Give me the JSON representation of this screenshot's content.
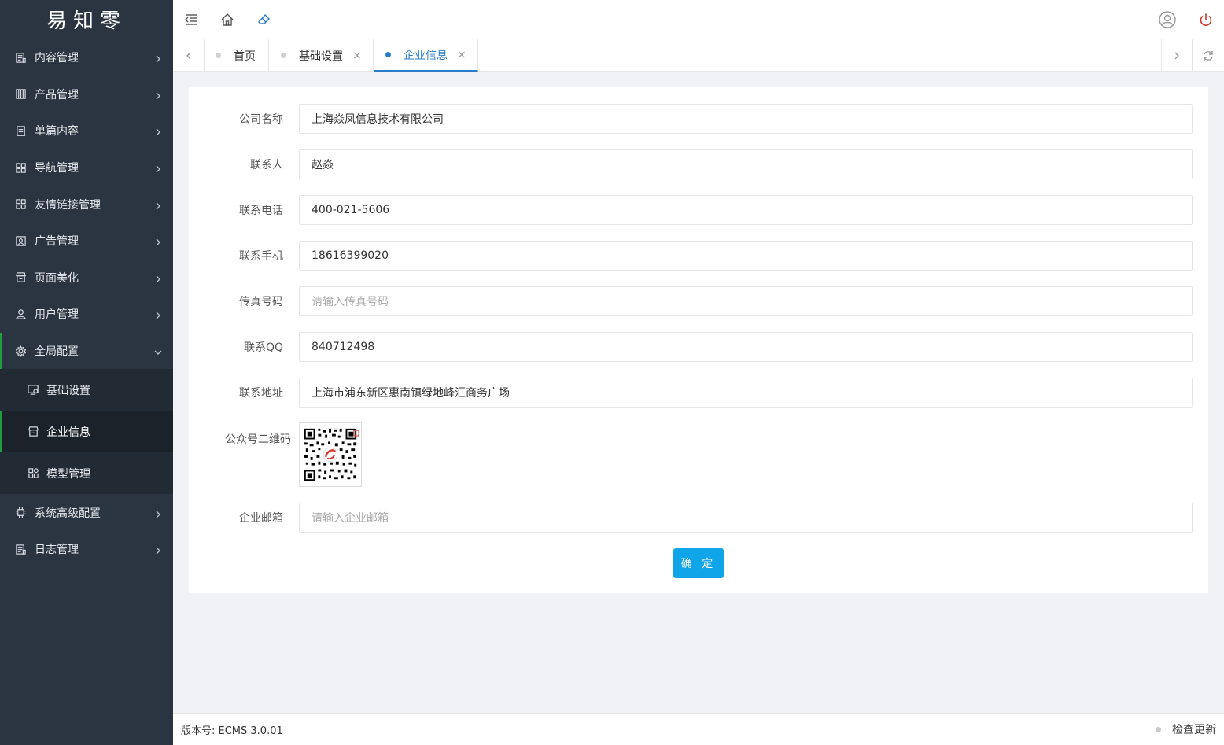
{
  "app": {
    "logo_text": "易知零"
  },
  "sidebar": {
    "items": [
      {
        "label": "内容管理",
        "icon": "document-list-icon"
      },
      {
        "label": "产品管理",
        "icon": "product-grid-icon"
      },
      {
        "label": "单篇内容",
        "icon": "single-doc-icon"
      },
      {
        "label": "导航管理",
        "icon": "nav-grid-icon"
      },
      {
        "label": "友情链接管理",
        "icon": "link-grid-icon"
      },
      {
        "label": "广告管理",
        "icon": "image-ad-icon"
      },
      {
        "label": "页面美化",
        "icon": "store-icon"
      },
      {
        "label": "用户管理",
        "icon": "user-icon"
      },
      {
        "label": "全局配置",
        "icon": "gear-icon"
      },
      {
        "label": "系统高级配置",
        "icon": "chip-icon"
      },
      {
        "label": "日志管理",
        "icon": "log-icon"
      }
    ],
    "sub_items": [
      {
        "label": "基础设置",
        "icon": "settings-screen-icon"
      },
      {
        "label": "企业信息",
        "icon": "store-icon"
      },
      {
        "label": "模型管理",
        "icon": "modules-icon"
      }
    ]
  },
  "tabs": [
    {
      "label": "首页"
    },
    {
      "label": "基础设置",
      "close": "×"
    },
    {
      "label": "企业信息",
      "close": "×"
    }
  ],
  "form": {
    "company_name": {
      "label": "公司名称",
      "value": "上海焱凤信息技术有限公司"
    },
    "contact": {
      "label": "联系人",
      "value": "赵焱"
    },
    "phone": {
      "label": "联系电话",
      "value": "400-021-5606"
    },
    "mobile": {
      "label": "联系手机",
      "value": "18616399020"
    },
    "fax": {
      "label": "传真号码",
      "placeholder": "请输入传真号码"
    },
    "qq": {
      "label": "联系QQ",
      "value": "840712498"
    },
    "address": {
      "label": "联系地址",
      "value": "上海市浦东新区惠南镇绿地峰汇商务广场"
    },
    "qrcode": {
      "label": "公众号二维码"
    },
    "email": {
      "label": "企业邮箱",
      "placeholder": "请输入企业邮箱"
    },
    "submit_label": "确 定"
  },
  "footer": {
    "version": "版本号: ECMS 3.0.01",
    "update_label": "检查更新"
  },
  "colors": {
    "sidebar_bg": "#2b3441",
    "accent_green": "#1f9d3f",
    "accent_blue": "#2a7cc8",
    "button_blue": "#0fa5e8"
  }
}
